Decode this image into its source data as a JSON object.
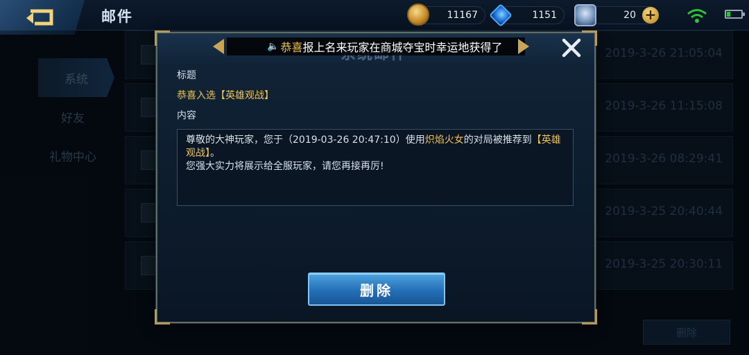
{
  "header": {
    "title": "邮件",
    "gold": "11167",
    "gems": "1151",
    "tickets": "20",
    "plus": "+"
  },
  "sidebar": {
    "tabs": [
      {
        "label": "系统",
        "active": true
      },
      {
        "label": "好友",
        "active": false
      },
      {
        "label": "礼物中心",
        "active": false
      }
    ]
  },
  "mail_list": {
    "dates": [
      "2019-3-26 21:05:04",
      "2019-3-26 11:15:08",
      "2019-3-26 08:29:41",
      "2019-3-25 20:40:44",
      "2019-3-25 20:30:11"
    ],
    "delete_label": "删除"
  },
  "modal": {
    "title": "系统邮件",
    "marquee": {
      "highlight": "恭喜",
      "text": "报上名来玩家在商城夺宝时幸运地获得了"
    },
    "subject_label": "标题",
    "subject": "恭喜入选【英雄观战】",
    "content_label": "内容",
    "content": {
      "part1": "尊敬的大神玩家，您于（2019-03-26 20:47:10）使用",
      "hero": "炽焰火女",
      "part2": "的对局被推荐到",
      "tag": "【英雄观战】",
      "part3": "。",
      "line2": "您强大实力将展示给全服玩家，请您再接再厉!"
    },
    "delete_label": "删除"
  },
  "colors": {
    "accent_gold": "#f0c250",
    "button_blue": "#246fb7",
    "wifi_green": "#2ec23a"
  }
}
